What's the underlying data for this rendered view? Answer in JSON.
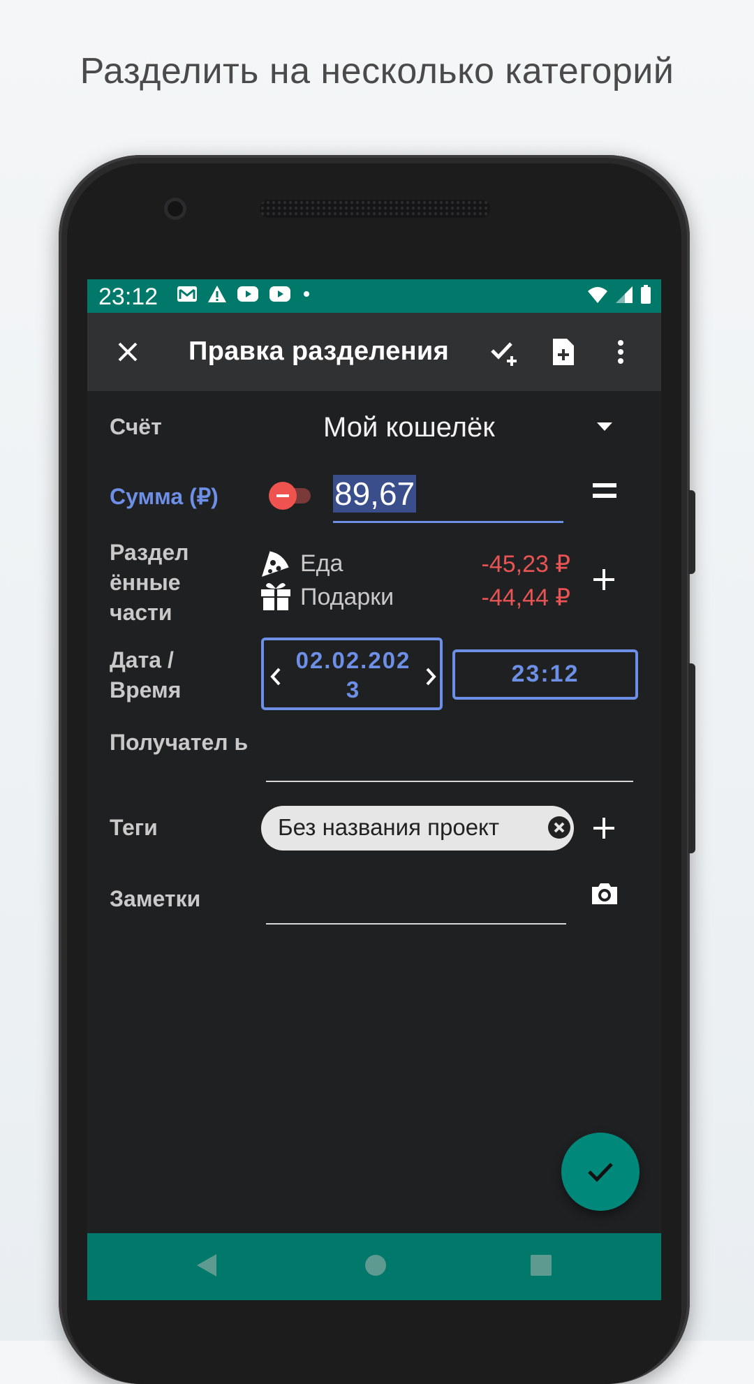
{
  "caption": "Разделить на несколько категорий",
  "status_bar": {
    "time": "23:12",
    "notification_icons": [
      "gmail-icon",
      "warning-icon",
      "youtube-icon",
      "youtube-icon",
      "dot-icon"
    ],
    "system_icons": [
      "wifi-icon",
      "signal-icon",
      "battery-icon"
    ]
  },
  "app_bar": {
    "title": "Правка разделения",
    "close_icon": "close-icon",
    "actions": [
      "check-plus-icon",
      "new-file-icon",
      "more-vert-icon"
    ]
  },
  "form": {
    "account": {
      "label": "Счёт",
      "value": "Мой кошелёк"
    },
    "amount": {
      "label": "Сумма (₽)",
      "value": "89,67",
      "sign": "minus"
    },
    "splits": {
      "label": "Раздел ённые части",
      "items": [
        {
          "icon": "pizza-icon",
          "name": "Еда",
          "amount": "-45,23 ₽"
        },
        {
          "icon": "gift-icon",
          "name": "Подарки",
          "amount": "-44,44 ₽"
        }
      ]
    },
    "datetime": {
      "label": "Дата / Время",
      "date": "02.02.2023",
      "time": "23:12"
    },
    "payee": {
      "label": "Получател ь",
      "value": ""
    },
    "tags": {
      "label": "Теги",
      "chip": "Без названия проект"
    },
    "notes": {
      "label": "Заметки",
      "value": ""
    }
  },
  "colors": {
    "status_bar": "#00796b",
    "app_bar": "#303133",
    "background": "#1f2022",
    "accent": "#6e8fe6",
    "negative": "#e85454",
    "fab": "#00897b"
  }
}
